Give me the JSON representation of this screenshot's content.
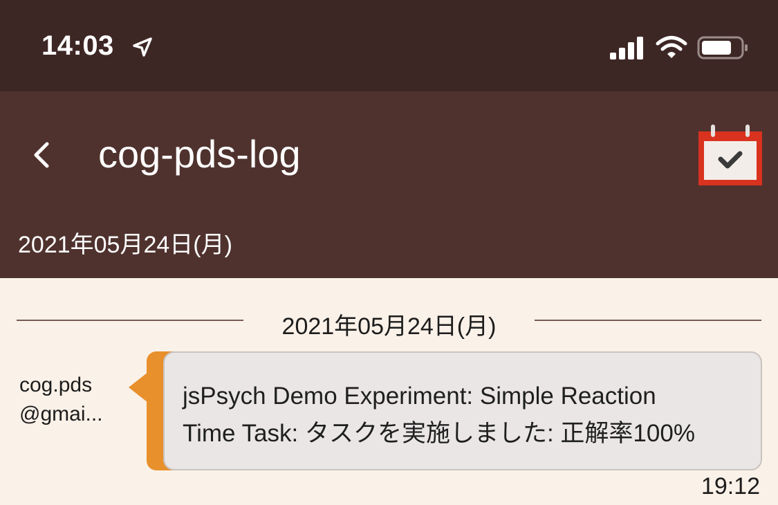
{
  "status_bar": {
    "time": "14:03",
    "icons": [
      "location-arrow-icon",
      "cellular-signal-icon",
      "wifi-icon",
      "battery-icon"
    ]
  },
  "header": {
    "back_icon": "chevron-left-icon",
    "title": "cog-pds-log",
    "calendar_icon": "calendar-check-icon",
    "subtitle": "2021年05月24日(月)"
  },
  "chat": {
    "divider_date": "2021年05月24日(月)",
    "messages": [
      {
        "sender_line1": "cog.pds",
        "sender_line2": "@gmai...",
        "text_line1": "jsPsych Demo Experiment: Simple Reaction",
        "text_line2": "Time Task: タスクを実施しました: 正解率100%",
        "time": "19:12"
      }
    ]
  },
  "colors": {
    "status_bar_bg": "#3d2725",
    "header_bg": "#4f322e",
    "content_bg": "#faf1e8",
    "bubble_accent": "#e8902c",
    "calendar_red": "#d9321f"
  }
}
